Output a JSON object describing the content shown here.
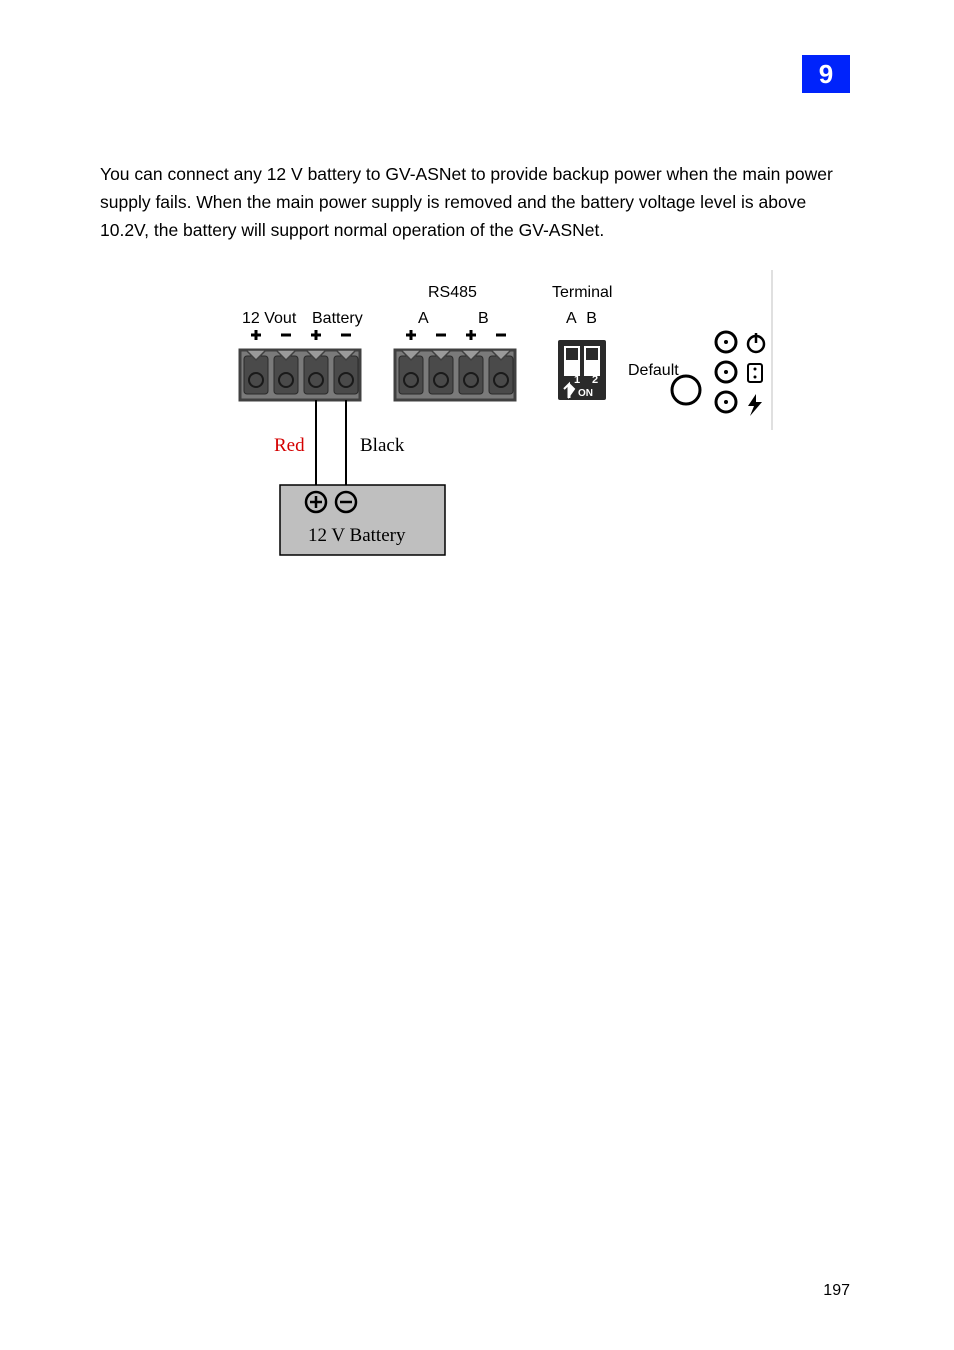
{
  "chapter": "9",
  "body_paragraph": "You can connect any 12 V battery to GV-ASNet to provide backup power when the main power supply fails. When the main power supply is removed and the battery voltage level is above 10.2V, the battery will support normal operation of the GV-ASNet.",
  "page_number": "197",
  "figure": {
    "labels": {
      "vout": "12 Vout",
      "battery_hdr": "Battery",
      "rs485": "RS485",
      "rs485_a": "A",
      "rs485_b": "B",
      "terminal": "Terminal",
      "terminal_ab": "A B",
      "dip1": "1",
      "dip2": "2",
      "dip_on": "ON",
      "default": "Default",
      "wire_red": "Red",
      "wire_black": "Black",
      "battery_box": "12 V Battery"
    }
  }
}
